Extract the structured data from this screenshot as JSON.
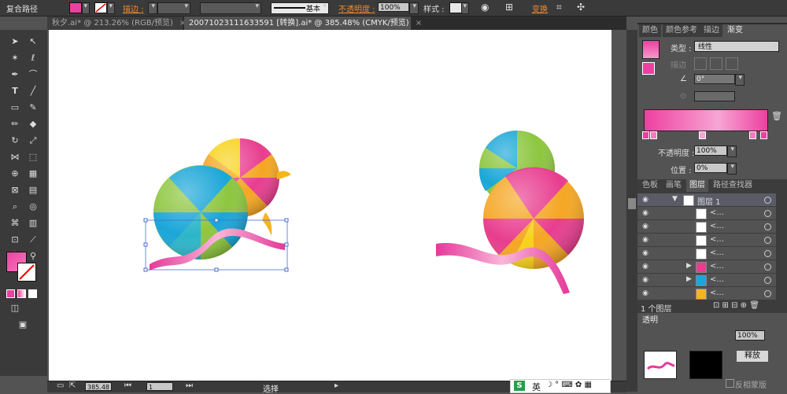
{
  "control_bar": {
    "object_type": "复合路径",
    "stroke_label": "描边 :",
    "stroke_style_label": "基本",
    "opacity_label": "不透明度 :",
    "opacity_value": "100%",
    "style_label": "样式 :",
    "transform_label": "变换",
    "fill_color": "#ee3fa0"
  },
  "doc_tabs": [
    {
      "label": "秋夕.ai* @ 213.26% (RGB/预览)",
      "close": "×"
    },
    {
      "label": "20071023111633591 [转换].ai* @ 385.48% (CMYK/预览)",
      "close": "×"
    }
  ],
  "gradient_panel": {
    "tabs": [
      "颜色",
      "颜色参考",
      "描边",
      "渐变"
    ],
    "type_label": "类型 :",
    "type_value": "线性",
    "stroke_label": "描边",
    "angle_value": "0°",
    "opacity_label": "不透明度 :",
    "opacity_value": "100%",
    "position_label": "位置 :",
    "position_value": "0%",
    "gradient_start": "#ee3fa0",
    "gradient_end": "#f7a6d4"
  },
  "layers_panel": {
    "tabs": [
      "色板",
      "画笔",
      "图层",
      "路径查找器"
    ],
    "layer_name": "图层 1",
    "sublayer_label": "<...",
    "footer_text": "1 个图层"
  },
  "transparency_panel": {
    "tab_label": "透明",
    "opacity_value": "100%",
    "mask_button": "释放",
    "invert_mask_label": "反相蒙版"
  },
  "status_bar": {
    "zoom_value": "385.48",
    "page_value": "1",
    "tool_label": "选择"
  },
  "ime_bar": {
    "lang": "英"
  }
}
